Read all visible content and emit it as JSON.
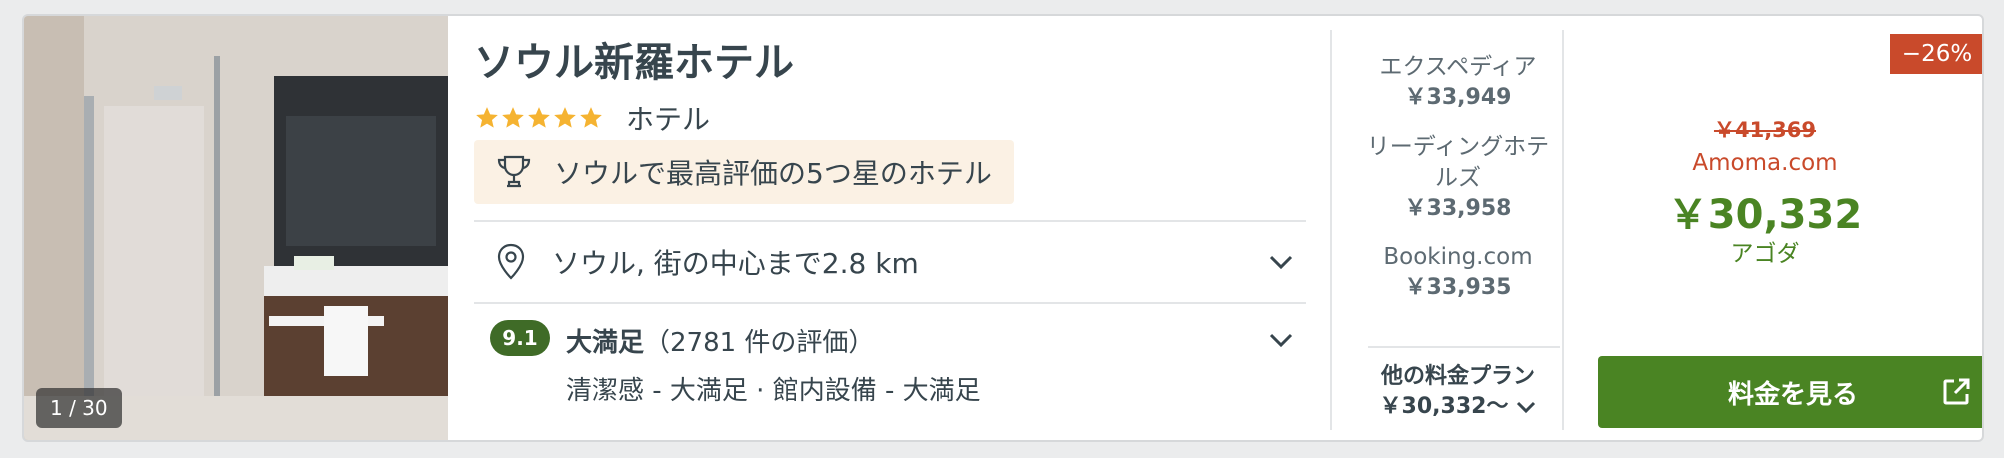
{
  "hotel": {
    "name": "ソウル新羅ホテル",
    "star_rating": 5,
    "type": "ホテル",
    "badge": "ソウルで最高評価の5つ星のホテル",
    "location": "ソウル, 街の中心まで2.8 km",
    "photo_counter": "1 / 30"
  },
  "rating": {
    "score": "9.1",
    "label": "大満足",
    "count": "（2781 件の評価）",
    "details": "清潔感 - 大満足 · 館内設備 - 大満足"
  },
  "offers": [
    {
      "name": "エクスペディア",
      "price": "￥33,949"
    },
    {
      "name": "リーディングホテルズ",
      "price": "￥33,958"
    },
    {
      "name": "Booking.com",
      "price": "￥33,935"
    }
  ],
  "other_plans": {
    "label": "他の料金プラン",
    "price": "￥30,332〜"
  },
  "deal": {
    "discount": "−26%",
    "old_price": "￥41,369",
    "old_provider": "Amoma.com",
    "price": "￥30,332",
    "provider": "アゴダ",
    "cta_label": "料金を見る"
  },
  "colors": {
    "accent_green": "#4a8423",
    "score_green": "#3f6b27",
    "discount_red": "#c94a2b",
    "star_yellow": "#f5b331",
    "badge_bg": "#fbf1e4"
  },
  "icons": {
    "trophy": "trophy-icon",
    "location": "location-pin-icon",
    "expand": "chevron-down-icon",
    "external": "external-link-icon"
  }
}
